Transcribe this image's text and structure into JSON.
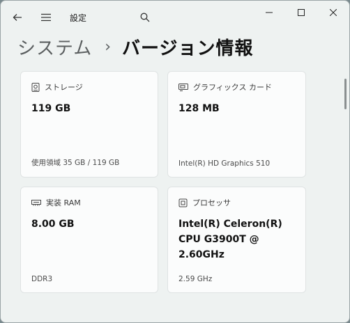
{
  "window": {
    "app_title": "設定"
  },
  "breadcrumb": {
    "parent": "システム",
    "separator": "›",
    "current": "バージョン情報"
  },
  "cards": {
    "storage": {
      "icon": "storage-icon",
      "label": "ストレージ",
      "value": "119 GB",
      "detail": "使用領域 35 GB / 119 GB"
    },
    "graphics": {
      "icon": "graphics-card-icon",
      "label": "グラフィックス カード",
      "value": "128 MB",
      "detail": "Intel(R) HD Graphics 510"
    },
    "memory": {
      "icon": "memory-icon",
      "label": "実装 RAM",
      "value": "8.00 GB",
      "detail": "DDR3"
    },
    "processor": {
      "icon": "processor-icon",
      "label": "プロセッサ",
      "value_lines": [
        "Intel(R) Celeron(R)",
        "CPU G3900T @",
        "2.60GHz"
      ],
      "detail": "2.59 GHz"
    }
  }
}
